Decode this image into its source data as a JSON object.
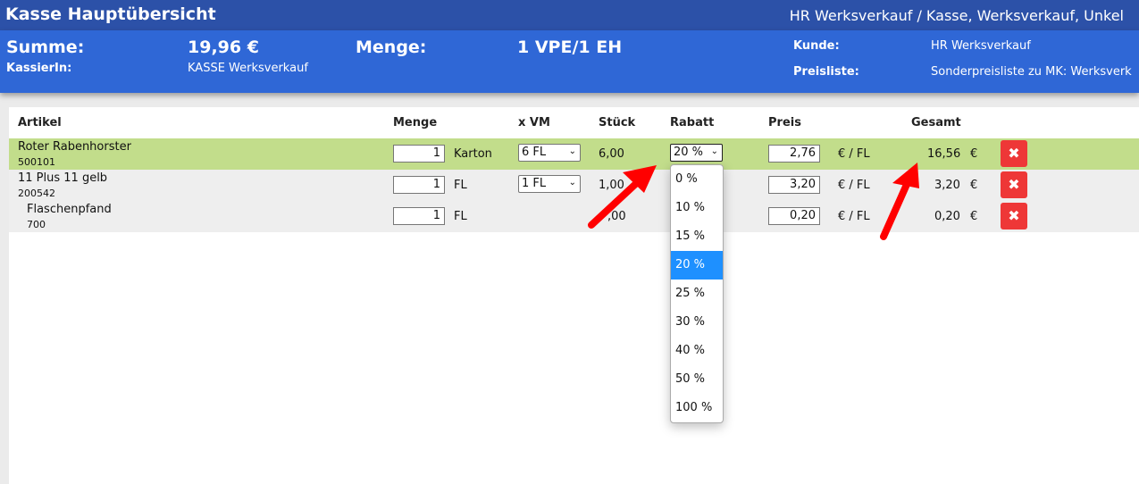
{
  "header": {
    "title": "Kasse Hauptübersicht",
    "context": "HR Werksverkauf / Kasse, Werksverkauf, Unkel"
  },
  "summary": {
    "summe_label": "Summe:",
    "summe_value": "19,96 €",
    "menge_label": "Menge:",
    "menge_value": "1 VPE/1 EH",
    "kassierin_label": "KassierIn:",
    "kassierin_value": "KASSE Werksverkauf",
    "kunde_label": "Kunde:",
    "kunde_value": "HR Werksverkauf",
    "preisliste_label": "Preisliste:",
    "preisliste_value": "Sonderpreisliste zu MK: Werksverk"
  },
  "table": {
    "columns": {
      "artikel": "Artikel",
      "menge": "Menge",
      "xvm": "x VM",
      "stueck": "Stück",
      "rabatt": "Rabatt",
      "preis": "Preis",
      "gesamt": "Gesamt"
    },
    "rows": [
      {
        "name": "Roter Rabenhorster",
        "number": "500101",
        "qty": "1",
        "unit": "Karton",
        "vm": "6 FL",
        "stueck": "6,00",
        "rabatt": "20 %",
        "preis": "2,76",
        "preis_unit": "€ / FL",
        "gesamt": "16,56",
        "currency": "€"
      },
      {
        "name": "11 Plus 11 gelb",
        "number": "200542",
        "qty": "1",
        "unit": "FL",
        "vm": "1 FL",
        "stueck": "1,00",
        "preis": "3,20",
        "preis_unit": "€ / FL",
        "gesamt": "3,20",
        "currency": "€"
      },
      {
        "name": "Flaschenpfand",
        "number": "700",
        "qty": "1",
        "unit": "FL",
        "stueck": ",00",
        "preis": "0,20",
        "preis_unit": "€ / FL",
        "gesamt": "0,20",
        "currency": "€"
      }
    ]
  },
  "rabatt_options": [
    "0 %",
    "10 %",
    "15 %",
    "20 %",
    "25 %",
    "30 %",
    "40 %",
    "50 %",
    "100 %"
  ],
  "rabatt_selected": "20 %",
  "icons": {
    "delete": "close-x-icon",
    "dropdown": "chevron-down-icon",
    "annotation": "red-arrow"
  },
  "colors": {
    "titlebar": "#2c51a8",
    "infobar": "#2f67d6",
    "selected_row": "#c2dd8b",
    "delete_button": "#ee3737",
    "selected_option": "#1e90ff",
    "arrow": "#ff0000"
  }
}
